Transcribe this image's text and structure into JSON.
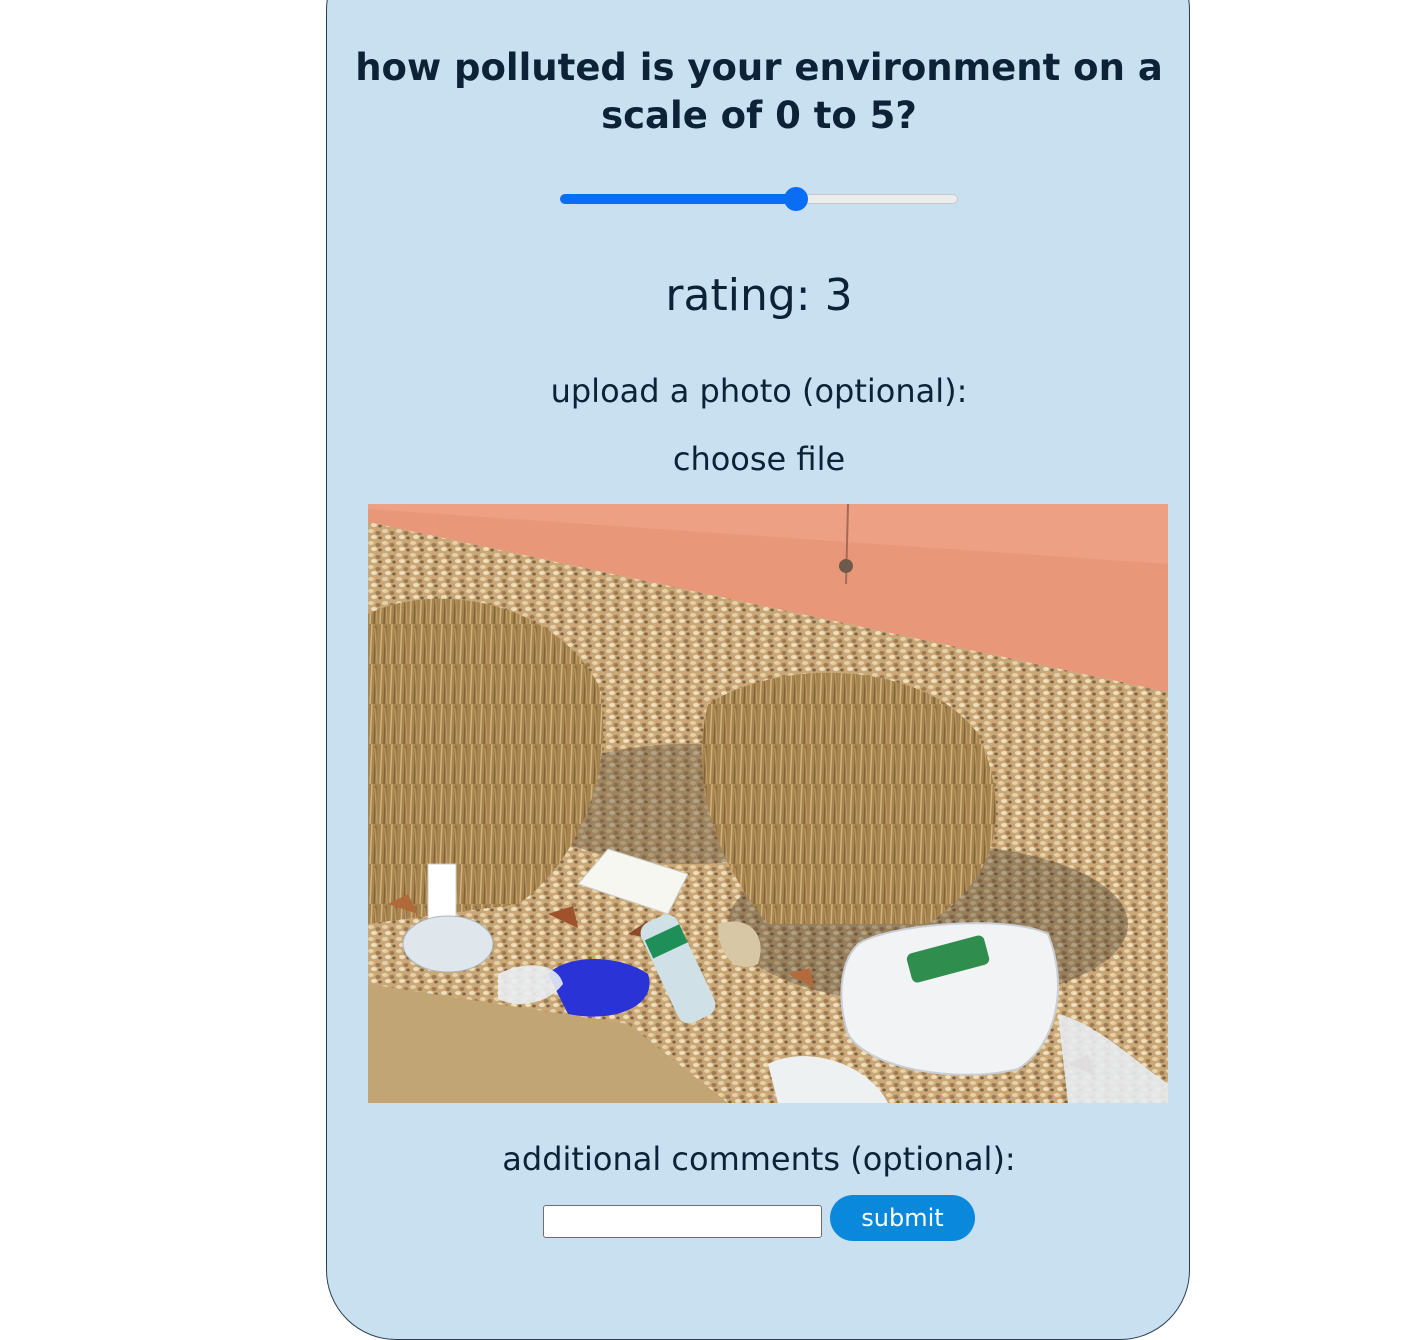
{
  "survey": {
    "question_line1": "how polluted is your environment on a",
    "question_line2": "scale of 0 to 5?",
    "slider": {
      "min": 0,
      "max": 5,
      "value": 3,
      "accent_color": "#0a6ef5"
    },
    "rating_text": "rating: 3",
    "upload_label": "upload a photo (optional):",
    "choose_file_label": "choose file",
    "photo_alt": "uploaded photo",
    "comments_label": "additional comments (optional):",
    "comments_value": "",
    "submit_label": "submit"
  },
  "colors": {
    "card_background": "#c8e0f0",
    "text": "#0d2236",
    "submit_button": "#0a88dc"
  }
}
